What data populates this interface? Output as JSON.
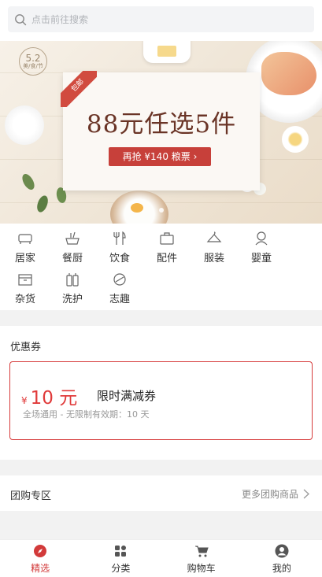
{
  "search": {
    "placeholder": "点击前往搜索"
  },
  "banner": {
    "badge_number": "5.2",
    "badge_sub": "美/食/节",
    "ribbon": "包邮",
    "headline": "88元任选5件",
    "pill": "再抢 ¥140 粮票 ›"
  },
  "categories": [
    {
      "label": "居家",
      "icon": "sofa-icon"
    },
    {
      "label": "餐厨",
      "icon": "kitchen-icon"
    },
    {
      "label": "饮食",
      "icon": "food-icon"
    },
    {
      "label": "配件",
      "icon": "bag-icon"
    },
    {
      "label": "服装",
      "icon": "hanger-icon"
    },
    {
      "label": "婴童",
      "icon": "baby-icon"
    },
    {
      "label": "杂货",
      "icon": "box-icon"
    },
    {
      "label": "洗护",
      "icon": "bottles-icon"
    },
    {
      "label": "志趣",
      "icon": "interest-icon"
    }
  ],
  "coupon_section": {
    "title": "优惠券",
    "currency": "¥",
    "amount": "10 元",
    "name": "限时满减券",
    "desc": "全场通用 - 无限制有效期：10 天"
  },
  "group_section": {
    "title": "团购专区",
    "more": "更多团购商品"
  },
  "tabbar": [
    {
      "label": "精选",
      "icon": "compass-icon",
      "active": true
    },
    {
      "label": "分类",
      "icon": "grid-icon",
      "active": false
    },
    {
      "label": "购物车",
      "icon": "cart-icon",
      "active": false
    },
    {
      "label": "我的",
      "icon": "user-icon",
      "active": false
    }
  ],
  "colors": {
    "accent": "#d23a3a",
    "banner_red": "#c7403a",
    "text": "#333333",
    "muted": "#999999"
  }
}
